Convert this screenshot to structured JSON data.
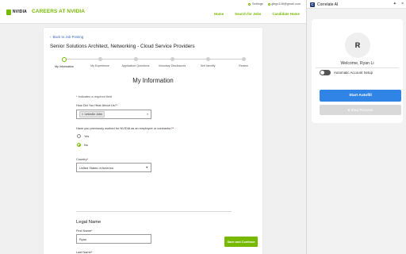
{
  "header": {
    "logo_text": "NVIDIA",
    "site_title": "CAREERS AT NVIDIA",
    "utility": {
      "settings": "Settings",
      "email": "gibgo148@gmail.com"
    },
    "nav": [
      "Home",
      "Search for Jobs",
      "Candidate Home"
    ]
  },
  "form": {
    "back_link": "Back to Job Posting",
    "job_title": "Senior Solutions Architect, Networking - Cloud Service Providers",
    "steps": [
      {
        "label": "My Information",
        "active": true
      },
      {
        "label": "My Experience",
        "active": false
      },
      {
        "label": "Application Questions",
        "active": false
      },
      {
        "label": "Voluntary Disclosures",
        "active": false
      },
      {
        "label": "Self Identify",
        "active": false
      },
      {
        "label": "Review",
        "active": false
      }
    ],
    "section_title": "My Information",
    "required_note": "* Indicates a required field",
    "how_heard": {
      "label": "How Did You Hear About Us?",
      "selected": "LinkedIn Jobs"
    },
    "prev_worked": {
      "label": "Have you previously worked for NVIDIA as an employee or contractor?",
      "options": [
        "Yes",
        "No"
      ],
      "selected": "No"
    },
    "country": {
      "label": "Country",
      "value": "United States of America"
    },
    "legal_name": {
      "heading": "Legal Name",
      "first_label": "First Name",
      "first_value": "Ryan",
      "last_label": "Last Name",
      "last_value": "Li"
    },
    "save_button": "Save and Continue"
  },
  "panel": {
    "title": "Correlate AI",
    "avatar_initial": "R",
    "welcome": "Welcome, Ryan Li",
    "toggle_label": "Automatic Account Setup",
    "toggle_on": false,
    "autofill_button": "Start Autofill",
    "stop_button": "Stop Process"
  },
  "colors": {
    "brand": "#76b900",
    "primary": "#2f84e6",
    "link": "#3b67b5"
  }
}
